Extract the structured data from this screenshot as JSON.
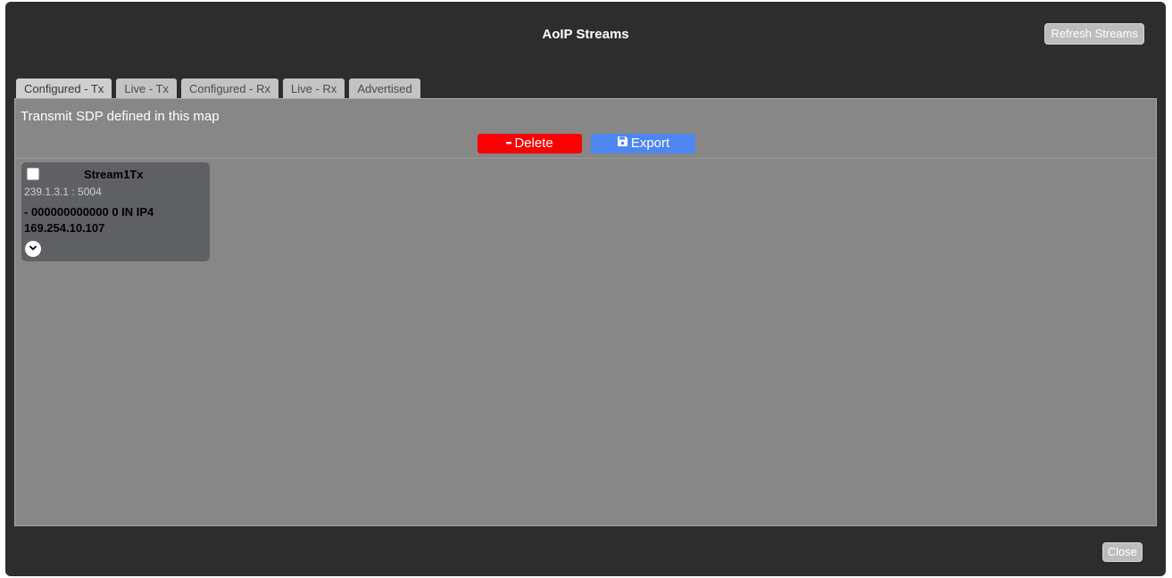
{
  "dialog": {
    "title": "AoIP Streams",
    "refresh_label": "Refresh Streams",
    "close_label": "Close"
  },
  "tabs": [
    {
      "label": "Configured - Tx",
      "active": true
    },
    {
      "label": "Live - Tx",
      "active": false
    },
    {
      "label": "Configured - Rx",
      "active": false
    },
    {
      "label": "Live - Rx",
      "active": false
    },
    {
      "label": "Advertised",
      "active": false
    }
  ],
  "panel": {
    "description": "Transmit SDP defined in this map",
    "delete_label": "Delete",
    "export_label": "Export"
  },
  "streams": [
    {
      "name": "Stream1Tx",
      "address": "239.1.3.1 : 5004",
      "origin_line1": "- 000000000000 0 IN IP4",
      "origin_line2": "169.254.10.107",
      "checked": false
    }
  ],
  "colors": {
    "delete": "#fb0000",
    "export": "#4d86f0",
    "dialog_bg": "#2d2d2d",
    "panel_bg": "#878787"
  },
  "icons": {
    "delete": "minus-icon",
    "export": "floppy-disk-icon",
    "expand": "chevron-down-icon"
  }
}
